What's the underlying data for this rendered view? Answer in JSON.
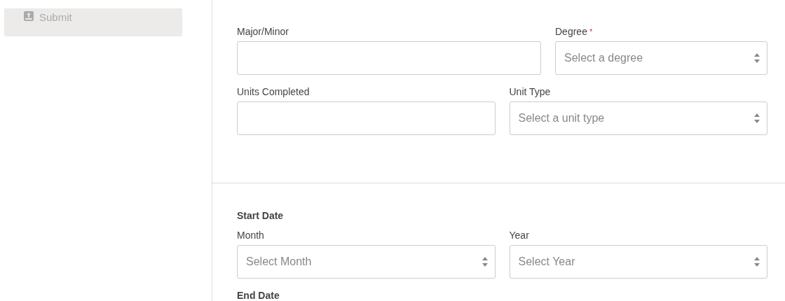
{
  "sidebar": {
    "items": [
      {
        "label": "Submit",
        "kind": "submit"
      }
    ]
  },
  "education": {
    "rows": [
      {
        "fields": [
          {
            "label": "Major/Minor",
            "kind": "text"
          },
          {
            "label": "Degree",
            "kind": "select",
            "required_mark": "*",
            "placeholder": "Select a degree"
          }
        ]
      },
      {
        "fields": [
          {
            "label": "Units Completed",
            "kind": "text"
          },
          {
            "label": "Unit Type",
            "kind": "select",
            "placeholder": "Select a unit type"
          }
        ]
      }
    ]
  },
  "dates": [
    {
      "heading": "Start Date",
      "fields": [
        {
          "label": "Month",
          "kind": "select",
          "placeholder": "Select Month"
        },
        {
          "label": "Year",
          "kind": "select",
          "placeholder": "Select Year"
        }
      ]
    },
    {
      "heading": "End Date"
    }
  ]
}
